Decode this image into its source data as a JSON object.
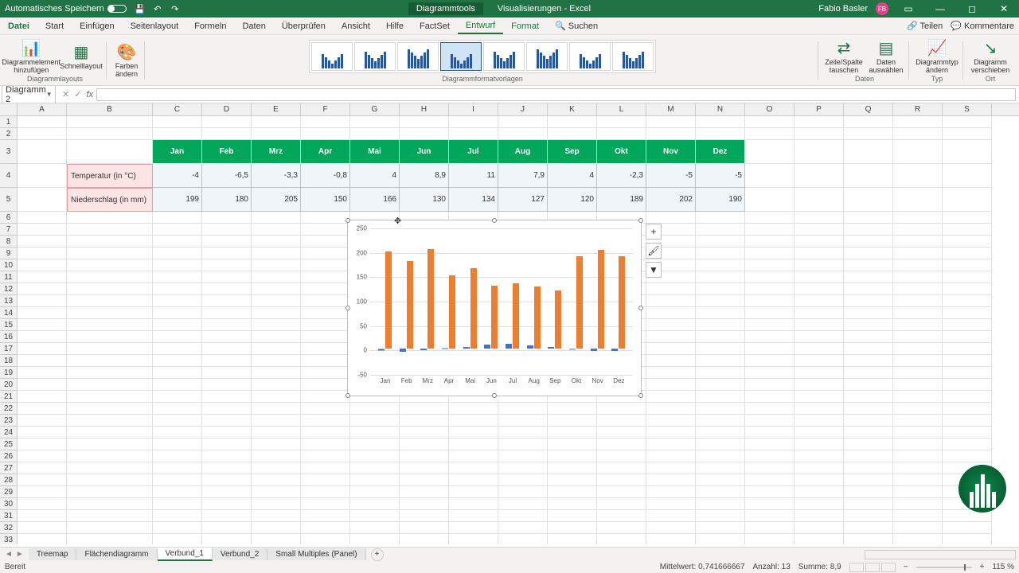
{
  "titlebar": {
    "autosave": "Automatisches Speichern",
    "tools": "Diagrammtools",
    "doc": "Visualisierungen - Excel",
    "user": "Fabio Basler"
  },
  "tabs": {
    "file": "Datei",
    "start": "Start",
    "insert": "Einfügen",
    "page": "Seitenlayout",
    "formulas": "Formeln",
    "data": "Daten",
    "review": "Überprüfen",
    "view": "Ansicht",
    "help": "Hilfe",
    "factset": "FactSet",
    "design": "Entwurf",
    "format": "Format",
    "search": "Suchen",
    "share": "Teilen",
    "comments": "Kommentare"
  },
  "ribbon": {
    "addElement": "Diagrammelement hinzufügen",
    "quickLayout": "Schnelllayout",
    "colors": "Farben ändern",
    "layouts": "Diagrammlayouts",
    "styles": "Diagrammformatvorlagen",
    "rowcol": "Zeile/Spalte tauschen",
    "selectData": "Daten auswählen",
    "dataGrp": "Daten",
    "changeType": "Diagrammtyp ändern",
    "typeGrp": "Typ",
    "moveChart": "Diagramm verschieben",
    "locGrp": "Ort"
  },
  "namebox": "Diagramm 2",
  "cols": [
    "A",
    "B",
    "C",
    "D",
    "E",
    "F",
    "G",
    "H",
    "I",
    "J",
    "K",
    "L",
    "M",
    "N",
    "O",
    "P",
    "Q",
    "R",
    "S"
  ],
  "table": {
    "rowlabels": [
      "Temperatur (in °C)",
      "Niederschlag (in mm)"
    ],
    "months": [
      "Jan",
      "Feb",
      "Mrz",
      "Apr",
      "Mai",
      "Jun",
      "Jul",
      "Aug",
      "Sep",
      "Okt",
      "Nov",
      "Dez"
    ],
    "temp": [
      "-4",
      "-6,5",
      "-3,3",
      "-0,8",
      "4",
      "8,9",
      "11",
      "7,9",
      "4",
      "-2,3",
      "-5",
      "-5"
    ],
    "prec": [
      "199",
      "180",
      "205",
      "150",
      "166",
      "130",
      "134",
      "127",
      "120",
      "189",
      "202",
      "190"
    ]
  },
  "sheets": {
    "treemap": "Treemap",
    "area": "Flächendiagramm",
    "v1": "Verbund_1",
    "v2": "Verbund_2",
    "sm": "Small Multiples (Panel)"
  },
  "status": {
    "ready": "Bereit",
    "avg": "Mittelwert: 0,741666667",
    "count": "Anzahl: 13",
    "sum": "Summe: 8,9",
    "zoom": "115 %"
  },
  "chart_data": {
    "type": "bar",
    "categories": [
      "Jan",
      "Feb",
      "Mrz",
      "Apr",
      "Mai",
      "Jun",
      "Jul",
      "Aug",
      "Sep",
      "Okt",
      "Nov",
      "Dez"
    ],
    "series": [
      {
        "name": "Temperatur (in °C)",
        "values": [
          -4,
          -6.5,
          -3.3,
          -0.8,
          4,
          8.9,
          11,
          7.9,
          4,
          -2.3,
          -5,
          -5
        ],
        "color": "#4472c4"
      },
      {
        "name": "Niederschlag (in mm)",
        "values": [
          199,
          180,
          205,
          150,
          166,
          130,
          134,
          127,
          120,
          189,
          202,
          190
        ],
        "color": "#ed7d31"
      }
    ],
    "ylim": [
      -50,
      250
    ],
    "yticks": [
      -50,
      0,
      50,
      100,
      150,
      200,
      250
    ]
  }
}
